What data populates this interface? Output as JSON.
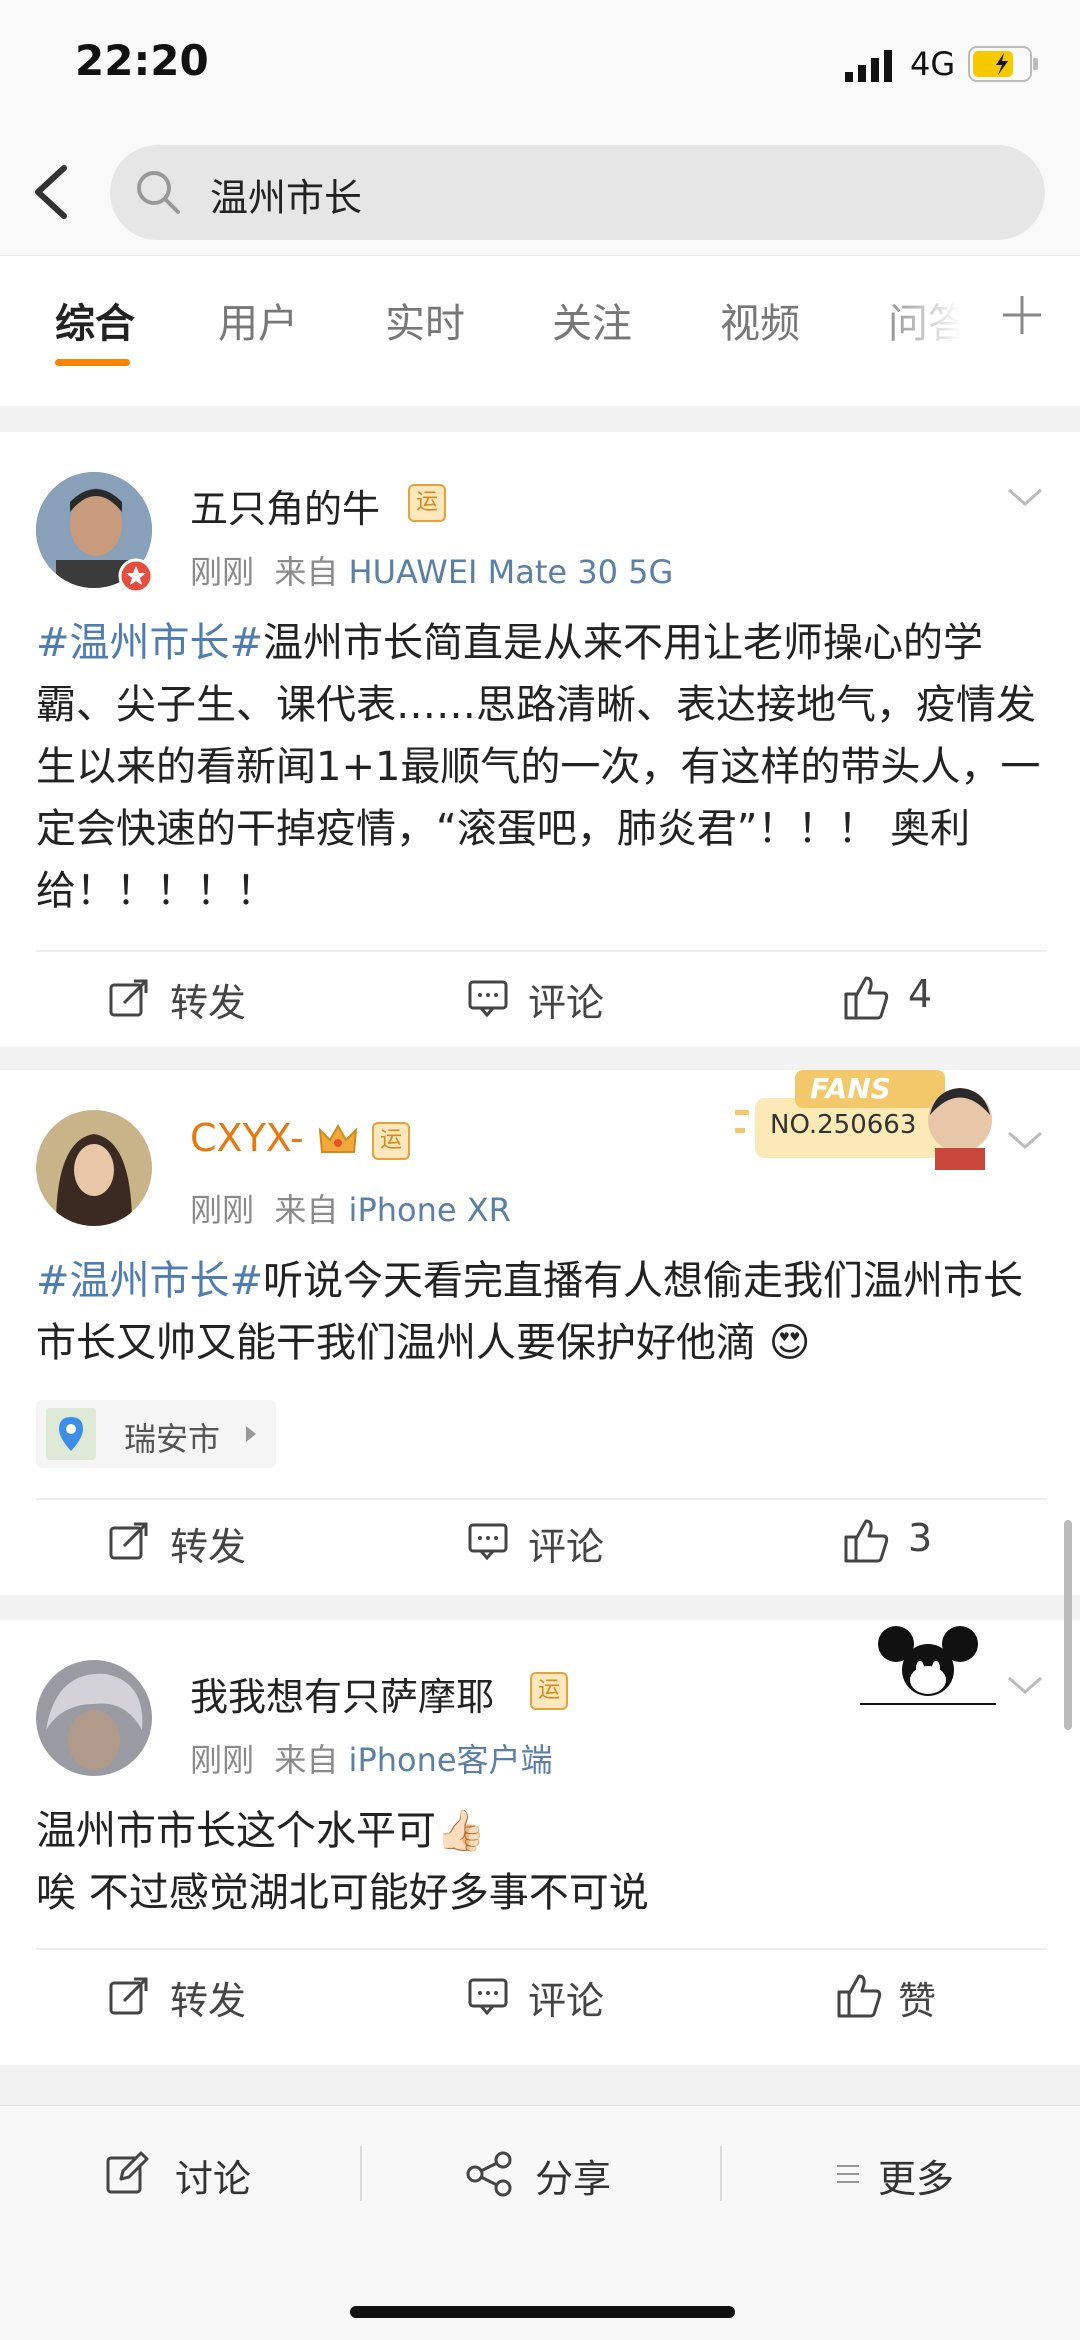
{
  "status": {
    "time": "22:20",
    "network": "4G"
  },
  "search": {
    "query": "温州市长"
  },
  "tabs": [
    {
      "label": "综合",
      "active": true
    },
    {
      "label": "用户"
    },
    {
      "label": "实时"
    },
    {
      "label": "关注"
    },
    {
      "label": "视频"
    },
    {
      "label": "问答"
    }
  ],
  "posts": [
    {
      "username": "五只角的牛",
      "badge": "运",
      "time": "刚刚",
      "from_prefix": "来自",
      "source": "HUAWEI Mate 30 5G",
      "hashtag": "#温州市长#",
      "text": "温州市长简直是从来不用让老师操心的学霸、尖子生、课代表……思路清晰、表达接地气，疫情发生以来的看新闻1+1最顺气的一次，有这样的带头人，一定会快速的干掉疫情，“滚蛋吧，肺炎君”！！！ 奥利给！！！！！",
      "repost": "转发",
      "comment": "评论",
      "likes": "4"
    },
    {
      "username": "CXYX-",
      "badge": "运",
      "fans_label": "FANS",
      "fans_no": "NO.250663",
      "time": "刚刚",
      "from_prefix": "来自",
      "source": "iPhone XR",
      "hashtag": "#温州市长#",
      "text": "听说今天看完直播有人想偷走我们温州市长 市长又帅又能干我们温州人要保护好他滴 😍",
      "location": "瑞安市",
      "repost": "转发",
      "comment": "评论",
      "likes": "3"
    },
    {
      "username": "我我想有只萨摩耶",
      "badge": "运",
      "time": "刚刚",
      "from_prefix": "来自",
      "source": "iPhone客户端",
      "text_line1": "温州市市长这个水平可👍🏻",
      "text_line2": "唉 不过感觉湖北可能好多事不可说",
      "repost": "转发",
      "comment": "评论",
      "likes": "赞"
    }
  ],
  "bottom_bar": {
    "discuss": "讨论",
    "share": "分享",
    "more": "更多"
  },
  "colors": {
    "accent": "#ff8200",
    "link": "#4f7db3",
    "vip_name": "#e8780e"
  }
}
